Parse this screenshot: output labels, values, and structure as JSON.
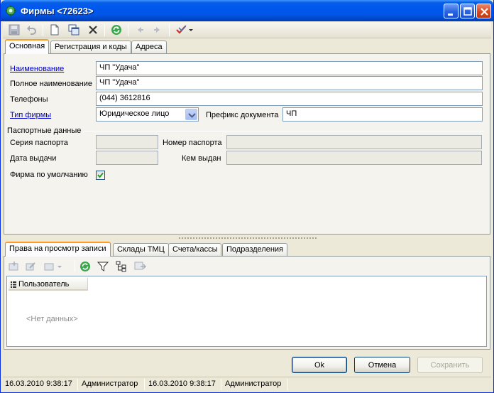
{
  "window": {
    "title": "Фирмы <72623>",
    "accent": "#0055e5"
  },
  "toolbar": {
    "items": [
      "save-icon",
      "undo-icon",
      "new-document-icon",
      "copy-icon",
      "delete-icon",
      "refresh-icon",
      "back-arrow-icon",
      "forward-arrow-icon",
      "check-menu-icon"
    ]
  },
  "tabs": [
    {
      "label": "Основная",
      "active": true
    },
    {
      "label": "Регистрация и коды",
      "active": false
    },
    {
      "label": "Адреса",
      "active": false
    }
  ],
  "form": {
    "name_label": "Наименование",
    "name_value": "ЧП \"Удача\"",
    "full_name_label": "Полное наименование",
    "full_name_value": "ЧП \"Удача\"",
    "phones_label": "Телефоны",
    "phones_value": "(044) 3612816",
    "firm_type_label": "Тип фирмы",
    "firm_type_value": "Юридическое лицо",
    "doc_prefix_label": "Префикс документа",
    "doc_prefix_value": "ЧП",
    "passport_group": "Паспортные данные",
    "passport_series_label": "Серия паспорта",
    "passport_series_value": "",
    "passport_number_label": "Номер паспорта",
    "passport_number_value": "",
    "issue_date_label": "Дата выдачи",
    "issue_date_value": "",
    "issued_by_label": "Кем выдан",
    "issued_by_value": "",
    "default_firm_label": "Фирма по умолчанию",
    "default_firm_checked": true
  },
  "lower_tabs": [
    {
      "label": "Права на просмотр записи",
      "active": true
    },
    {
      "label": "Склады ТМЦ",
      "active": false
    },
    {
      "label": "Счета/кассы",
      "active": false
    },
    {
      "label": "Подразделения",
      "active": false
    }
  ],
  "grid": {
    "column_user": "Пользователь",
    "empty_text": "<Нет данных>"
  },
  "buttons": {
    "ok": "Ok",
    "cancel": "Отмена",
    "save": "Сохранить"
  },
  "status": {
    "created_date": "16.03.2010 9:38:17",
    "created_by": "Администратор",
    "modified_date": "16.03.2010 9:38:17",
    "modified_by": "Администратор"
  }
}
